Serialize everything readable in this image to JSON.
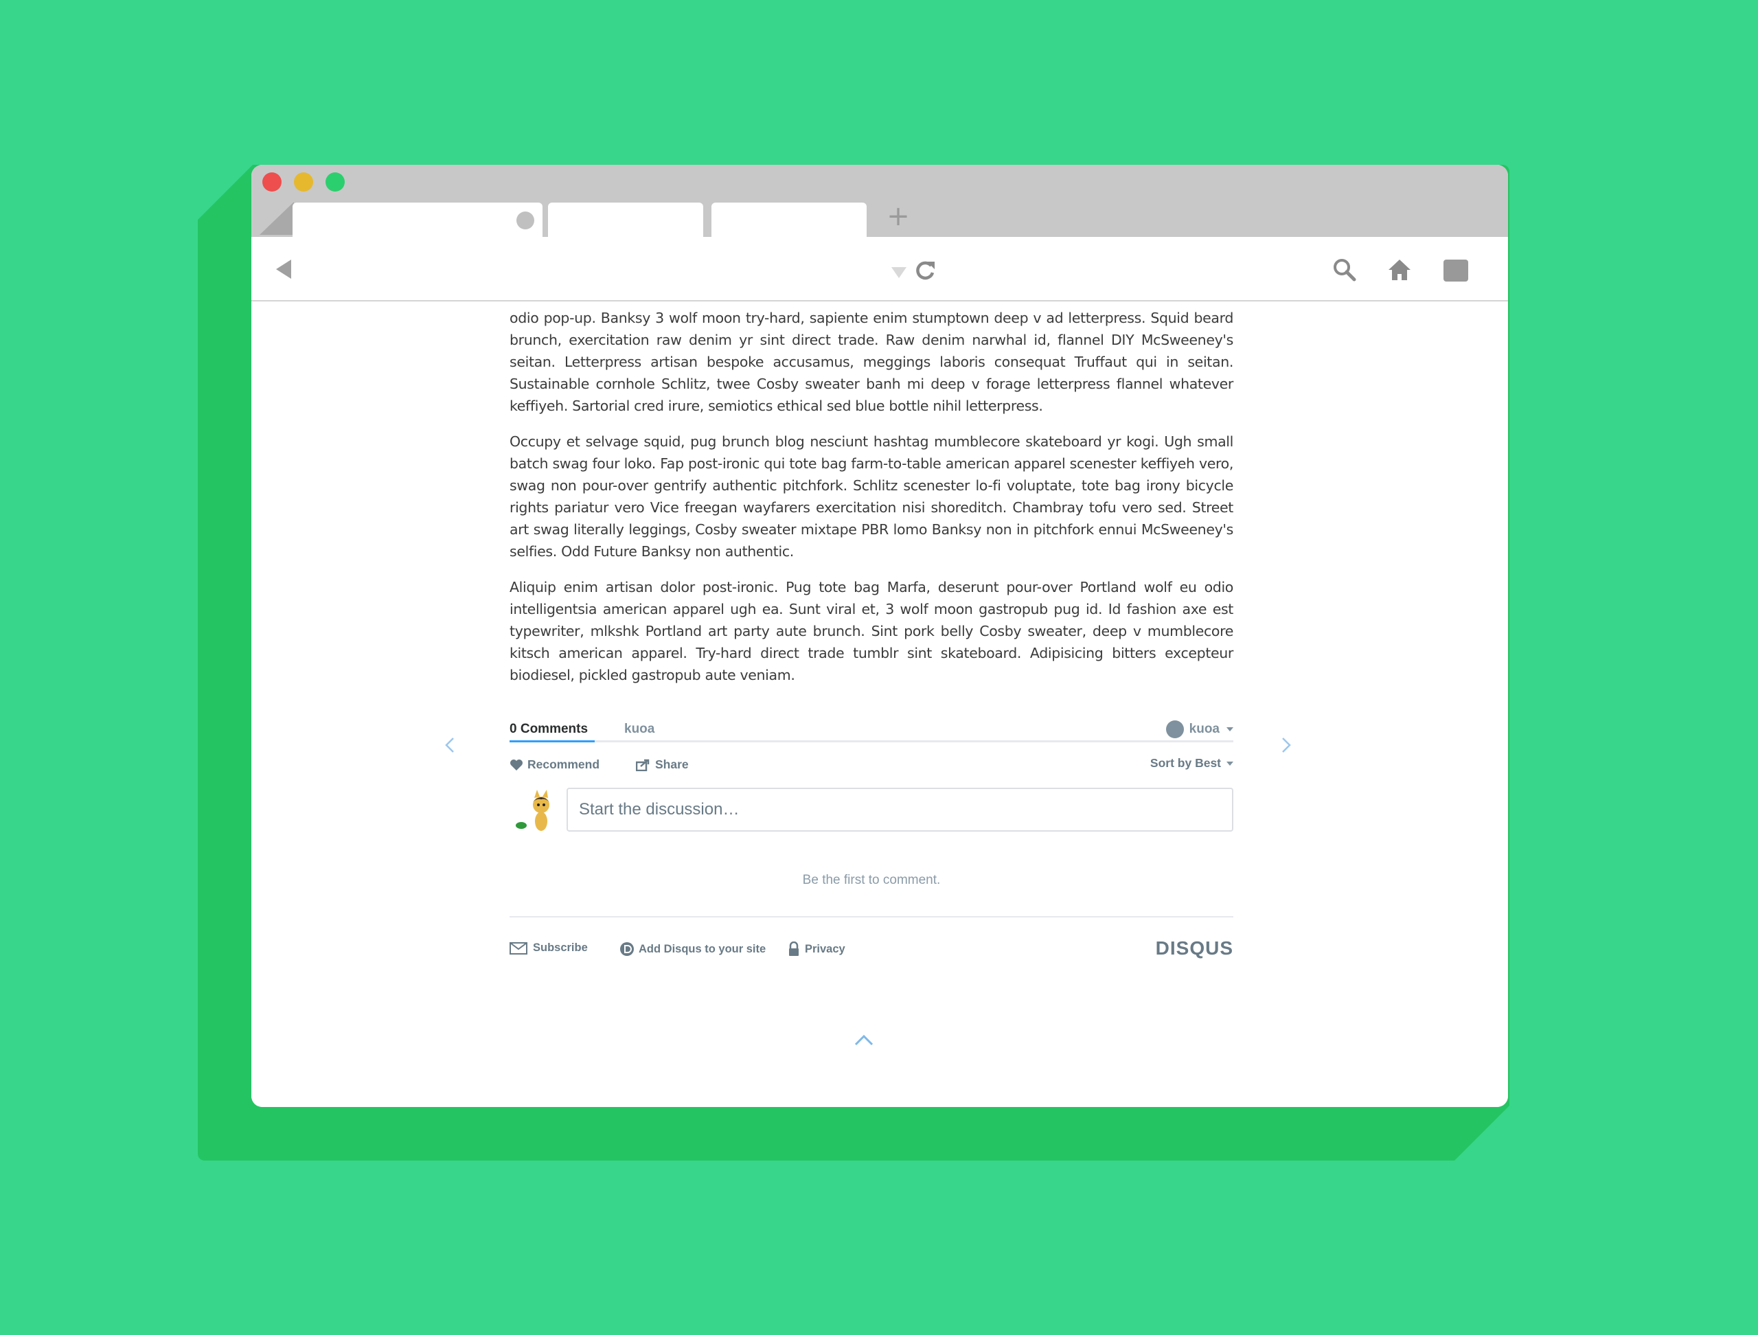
{
  "article": {
    "paragraphs": [
      "odio pop-up. Banksy 3 wolf moon try-hard, sapiente enim stumptown deep v ad letterpress. Squid beard brunch, exercitation raw denim yr sint direct trade. Raw denim narwhal id, flannel DIY McSweeney's seitan. Letterpress artisan bespoke accusamus, meggings laboris consequat Truffaut qui in seitan. Sustainable cornhole Schlitz, twee Cosby sweater banh mi deep v forage letterpress flannel whatever keffiyeh. Sartorial cred irure, semiotics ethical sed blue bottle nihil letterpress.",
      "Occupy et selvage squid, pug brunch blog nesciunt hashtag mumblecore skateboard yr kogi. Ugh small batch swag four loko. Fap post-ironic qui tote bag farm-to-table american apparel scenester keffiyeh vero, swag non pour-over gentrify authentic pitchfork. Schlitz scenester lo-fi voluptate, tote bag irony bicycle rights pariatur vero Vice freegan wayfarers exercitation nisi shoreditch. Chambray tofu vero sed. Street art swag literally leggings, Cosby sweater mixtape PBR lomo Banksy non in pitchfork ennui McSweeney's selfies. Odd Future Banksy non authentic.",
      "Aliquip enim artisan dolor post-ironic. Pug tote bag Marfa, deserunt pour-over Portland wolf eu odio intelligentsia american apparel ugh ea. Sunt viral et, 3 wolf moon gastropub pug id. Id fashion axe est typewriter, mlkshk Portland art party aute brunch. Sint pork belly Cosby sweater, deep v mumblecore kitsch american apparel. Try-hard direct trade tumblr sint skateboard. Adipisicing bitters excepteur biodiesel, pickled gastropub aute veniam."
    ]
  },
  "disqus": {
    "comments_tab": "0 Comments",
    "site_tab": "kuoa",
    "user_name": "kuoa",
    "recommend": "Recommend",
    "share": "Share",
    "sort": "Sort by Best",
    "input_placeholder": "Start the discussion…",
    "empty_message": "Be the first to comment.",
    "subscribe": "Subscribe",
    "add_disqus": "Add Disqus to your site",
    "privacy": "Privacy",
    "logo": "DISQUS"
  },
  "colors": {
    "background": "#38d68a",
    "shadow": "#24c463",
    "accent_blue": "#2e9fff"
  },
  "icons": [
    "back-icon",
    "reload-icon",
    "search-icon",
    "home-icon",
    "menu-icon",
    "heart-icon",
    "share-icon",
    "mail-icon",
    "disqus-d-icon",
    "lock-icon",
    "chevron-left-icon",
    "chevron-right-icon",
    "chevron-up-icon"
  ]
}
